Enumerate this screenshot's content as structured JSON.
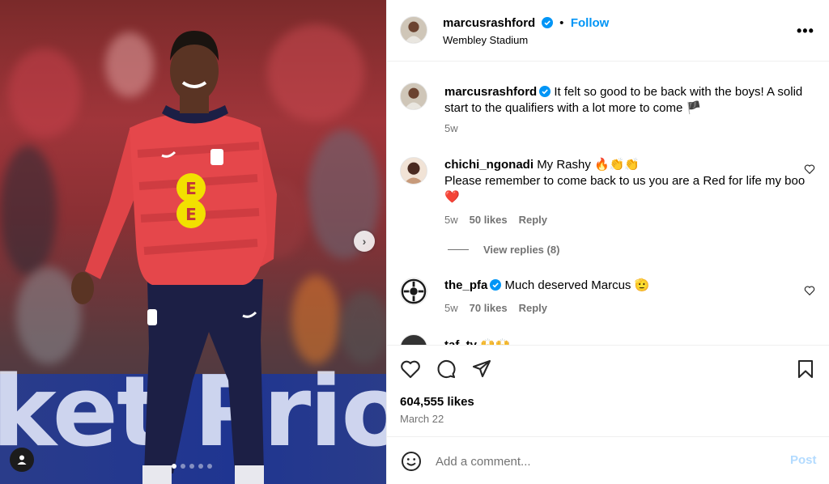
{
  "header": {
    "username": "marcusrashford",
    "follow_label": "Follow",
    "location": "Wembley Stadium",
    "more_icon": "more-horizontal-icon"
  },
  "media": {
    "banner_text": "ket Prior",
    "carousel": {
      "total": 5,
      "active": 0
    }
  },
  "caption": {
    "username": "marcusrashford",
    "text": "It felt so good to be back with the boys! A solid start to the qualifiers with a lot more to come 🏴",
    "age": "5w"
  },
  "comments": [
    {
      "username": "chichi_ngonadi",
      "text": "My Rashy 🔥👏👏",
      "text2": "Please remember to come back to us you are a Red for life my boo ❤️",
      "age": "5w",
      "likes": "50 likes",
      "reply_label": "Reply",
      "view_replies": "View replies (8)"
    },
    {
      "username": "the_pfa",
      "text": "Much deserved Marcus 🫡",
      "age": "5w",
      "likes": "70 likes",
      "reply_label": "Reply"
    },
    {
      "username": "taf_tv",
      "text": "🙌🙌"
    }
  ],
  "post": {
    "likes": "604,555 likes",
    "date": "March 22"
  },
  "composer": {
    "placeholder": "Add a comment...",
    "post_label": "Post"
  },
  "colors": {
    "accent": "#0095f6",
    "post_disabled": "#b3dbff",
    "muted": "#737373",
    "heart_red": "#ed4956"
  }
}
